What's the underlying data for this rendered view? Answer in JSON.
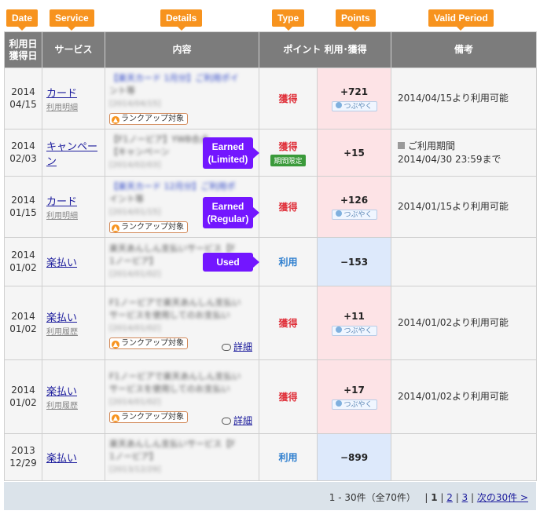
{
  "callouts": {
    "date": "Date",
    "service": "Service",
    "details": "Details",
    "type": "Type",
    "points": "Points",
    "valid_period": "Valid Period",
    "earned_limited": "Earned (Limited)",
    "earned_regular": "Earned (Regular)",
    "used": "Used"
  },
  "headers": {
    "date": "利用日 獲得日",
    "service": "サービス",
    "details": "内容",
    "points": "ポイント 利用･獲得",
    "notes": "備考"
  },
  "labels": {
    "earned": "獲得",
    "used": "利用",
    "limited_badge": "期間限定",
    "rank_up": "ランクアップ対象",
    "tsubuyaku": "つぶやく",
    "detail_link": "詳細",
    "usage_period": "ご利用期間"
  },
  "rows": [
    {
      "date_year": "2014",
      "date_md": "04/15",
      "service": "カード",
      "service_sub": "利用明細",
      "detail_line1": "【楽天カード 1月分】ご利用ポイ",
      "detail_line2": "ント等",
      "detail_date": "[2014/04/15]",
      "type": "獲得",
      "points": "+721",
      "note": "2014/04/15より利用可能"
    },
    {
      "date_year": "2014",
      "date_md": "02/03",
      "service": "キャンペーン",
      "service_sub": "",
      "detail_line1": "【F1ノービア】YWB合点",
      "detail_line2": "【キャンペーン",
      "detail_date": "[2014/02/03]",
      "type": "獲得",
      "points": "+15",
      "note_line1": "ご利用期間",
      "note_line2": "2014/04/30 23:59まで"
    },
    {
      "date_year": "2014",
      "date_md": "01/15",
      "service": "カード",
      "service_sub": "利用明細",
      "detail_line1": "【楽天カード 12月分】ご利用ポ",
      "detail_line2": "イント等",
      "detail_date": "[2014/01/15]",
      "type": "獲得",
      "points": "+126",
      "note": "2014/01/15より利用可能"
    },
    {
      "date_year": "2014",
      "date_md": "01/02",
      "service": "楽払い",
      "service_sub": "",
      "detail_line1": "楽天あんしん支払いサービス【F",
      "detail_line2": "1ノービア】",
      "detail_date": "[2014/01/02]",
      "type": "利用",
      "points": "−153",
      "note": ""
    },
    {
      "date_year": "2014",
      "date_md": "01/02",
      "service": "楽払い",
      "service_sub": "利用履歴",
      "detail_line1": "F1ノービアで楽天あんしん支払い",
      "detail_line2": "サービスを使用してのお支払い",
      "detail_date": "[2014/01/02]",
      "type": "獲得",
      "points": "+11",
      "note": "2014/01/02より利用可能"
    },
    {
      "date_year": "2014",
      "date_md": "01/02",
      "service": "楽払い",
      "service_sub": "利用履歴",
      "detail_line1": "F1ノービアで楽天あんしん支払い",
      "detail_line2": "サービスを使用してのお支払い",
      "detail_date": "[2014/01/02]",
      "type": "獲得",
      "points": "+17",
      "note": "2014/01/02より利用可能"
    },
    {
      "date_year": "2013",
      "date_md": "12/29",
      "service": "楽払い",
      "service_sub": "",
      "detail_line1": "楽天あんしん支払いサービス【F",
      "detail_line2": "1ノービア】",
      "detail_date": "[2013/12/29]",
      "type": "利用",
      "points": "−899",
      "note": ""
    }
  ],
  "pager": {
    "range": "1 - 30件（全70件）",
    "page1": "1",
    "page2": "2",
    "page3": "3",
    "next": "次の30件 >"
  }
}
